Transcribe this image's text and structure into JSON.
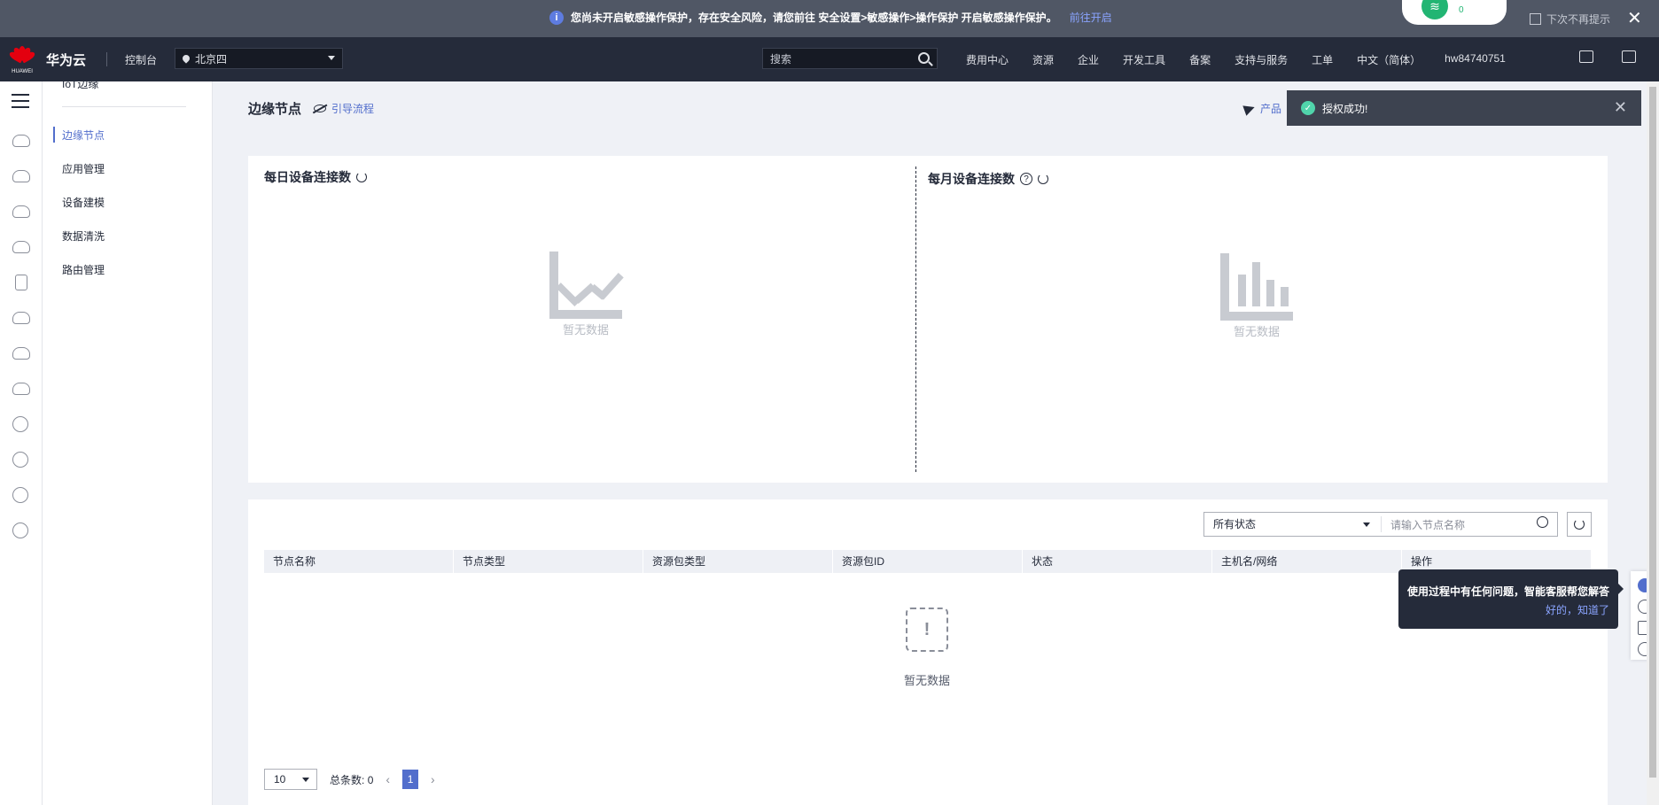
{
  "banner": {
    "message": "您尚未开启敏感操作保护，存在安全风险，请您前往 安全设置>敏感操作>操作保护 开启敏感操作保护。",
    "link": "前往开启",
    "dont_show": "下次不再提示",
    "widget_count": "0"
  },
  "topnav": {
    "logo_text": "HUAWEI",
    "brand": "华为云",
    "console": "控制台",
    "region": "北京四",
    "search_placeholder": "搜索",
    "links": [
      "费用中心",
      "资源",
      "企业",
      "开发工具",
      "备案",
      "支持与服务",
      "工单",
      "中文（简体）",
      "hw84740751"
    ]
  },
  "subnav": {
    "cut_item": "IoT边缘",
    "items": [
      "边缘节点",
      "应用管理",
      "设备建模",
      "数据清洗",
      "路由管理"
    ],
    "active_index": 0
  },
  "page": {
    "title": "边缘节点",
    "guide": "引导流程",
    "product_link": "产品"
  },
  "charts": {
    "daily_title": "每日设备连接数",
    "monthly_title": "每月设备连接数",
    "help_glyph": "?",
    "empty_text": "暂无数据"
  },
  "table": {
    "status_select": "所有状态",
    "search_placeholder": "请输入节点名称",
    "columns": [
      "节点名称",
      "节点类型",
      "资源包类型",
      "资源包ID",
      "状态",
      "主机名/网络",
      "操作"
    ],
    "empty_glyph": "!",
    "empty_text": "暂无数据",
    "page_size": "10",
    "total_label": "总条数:",
    "total": "0",
    "current_page": "1"
  },
  "toast": {
    "message": "授权成功!"
  },
  "tooltip": {
    "message": "使用过程中有任何问题，智能客服帮您解答",
    "action": "好的，知道了"
  }
}
